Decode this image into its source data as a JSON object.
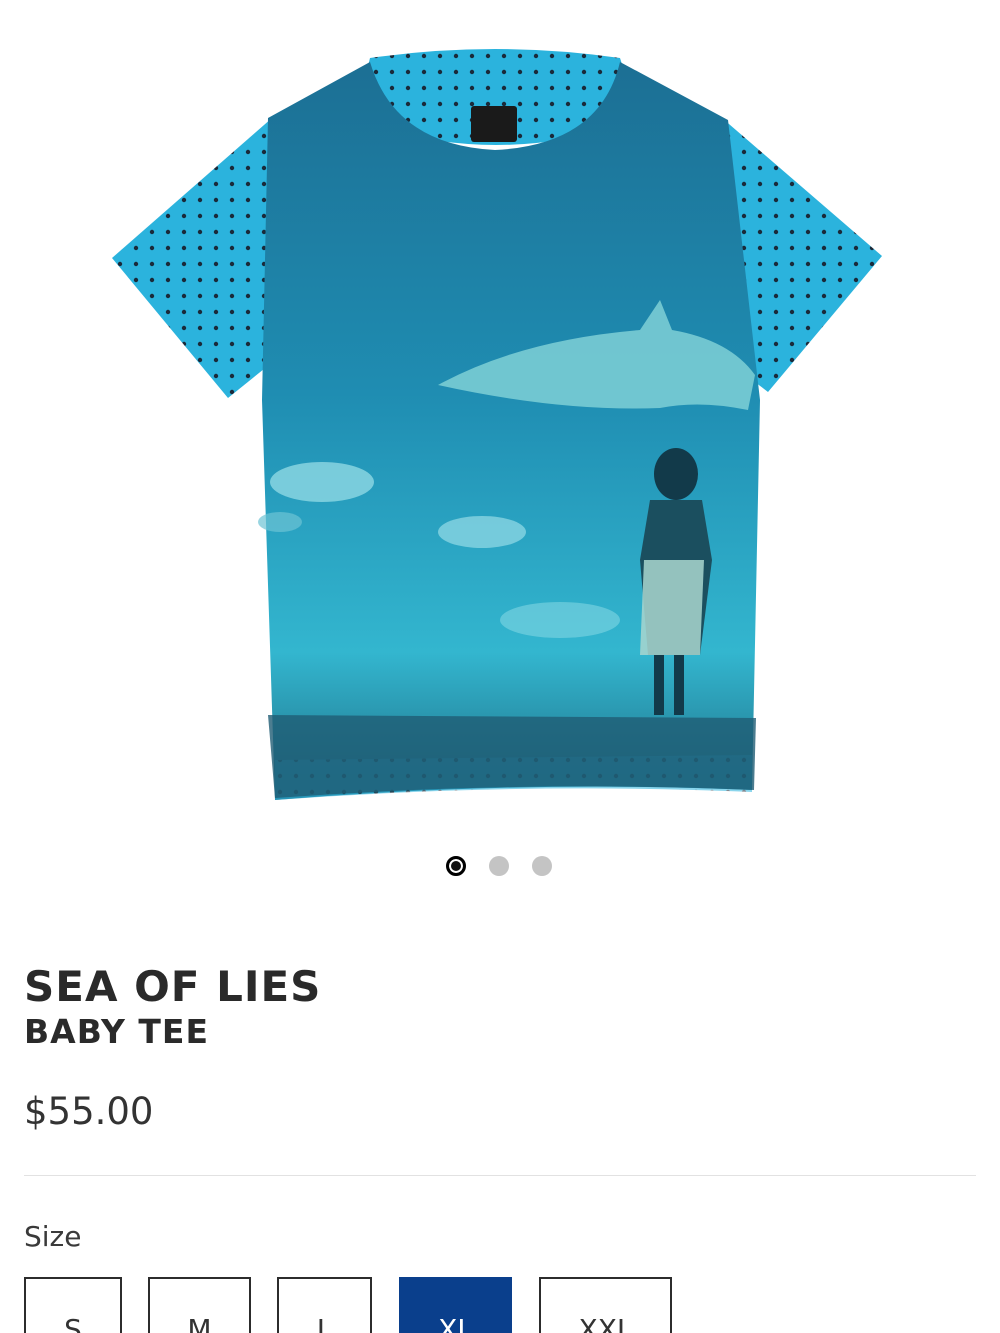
{
  "product": {
    "title": "SEA OF LIES",
    "subtitle": "BABY TEE",
    "price": "$55.00"
  },
  "gallery": {
    "image_count": 3,
    "active_index": 0
  },
  "size": {
    "label": "Size",
    "options": [
      "S",
      "M",
      "L",
      "XL",
      "XXL"
    ],
    "selected": "XL"
  },
  "colors": {
    "accent": "#0a3f8c",
    "shirt_body": "#1f8fb0",
    "shirt_sleeve": "#2db3dc"
  }
}
